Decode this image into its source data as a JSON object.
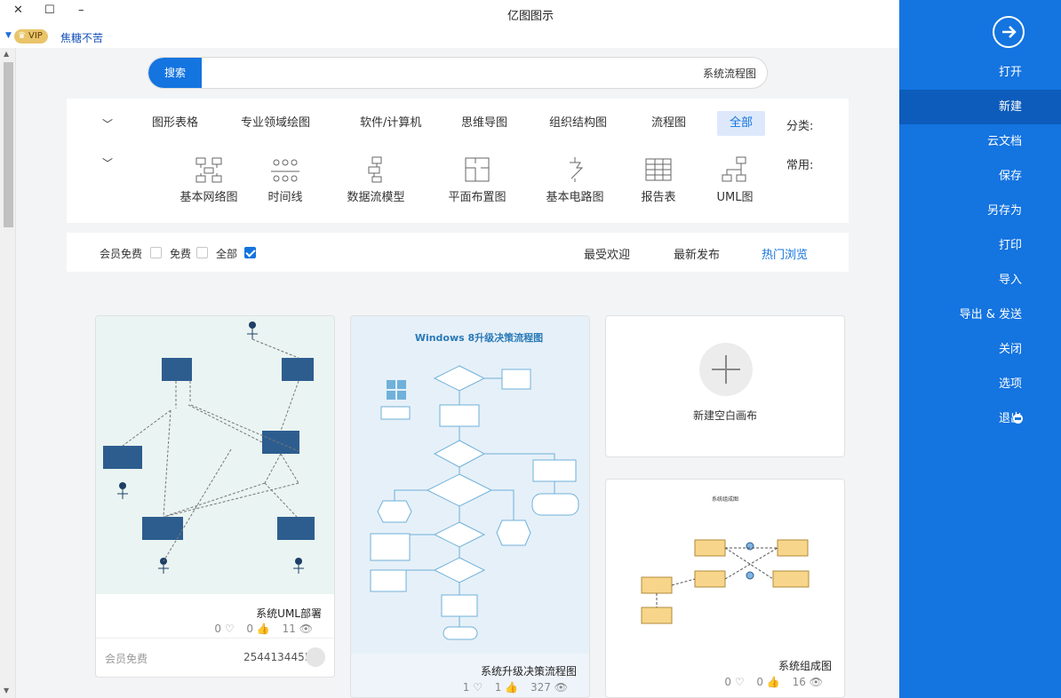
{
  "window": {
    "title": "亿图图示",
    "close": "✕",
    "maximize": "☐",
    "minimize": "–"
  },
  "user": {
    "vip": "VIP",
    "name": "焦糖不苦"
  },
  "search": {
    "button": "搜索",
    "value": "系统流程图"
  },
  "categories": {
    "label": "分类:",
    "items": [
      "全部",
      "流程图",
      "组织结构图",
      "思维导图",
      "软件/计算机",
      "专业领域绘图",
      "图形表格"
    ]
  },
  "common": {
    "label": "常用:",
    "items": [
      "UML图",
      "报告表",
      "基本电路图",
      "平面布置图",
      "数据流模型",
      "时间线",
      "基本网络图"
    ]
  },
  "filters": {
    "tabs": [
      "热门浏览",
      "最新发布",
      "最受欢迎"
    ],
    "checks": [
      "全部",
      "免费",
      "会员免费"
    ]
  },
  "cards": {
    "blank": {
      "label": "新建空白画布"
    },
    "uml": {
      "title": "系统UML部署",
      "views": "11",
      "likes": "0",
      "hearts": "0",
      "author": "2544134455",
      "tag": "会员免费"
    },
    "win": {
      "title": "系统升级决策流程图",
      "heading": "Windows 8升级决策流程图",
      "views": "327",
      "likes": "1",
      "hearts": "1"
    },
    "comp": {
      "title": "系统组成图",
      "heading": "系统组成图",
      "views": "16",
      "likes": "0",
      "hearts": "0"
    }
  },
  "sidebar": {
    "items": [
      "打开",
      "新建",
      "云文档",
      "保存",
      "另存为",
      "打印",
      "导入",
      "导出 & 发送",
      "关闭",
      "选项",
      "退出"
    ]
  },
  "colors": {
    "accent": "#1474e0",
    "sidebar": "#1474e0",
    "sidebar_selected": "#0d5cbb",
    "node_dark": "#2d5d8f",
    "node_yellow": "#f7d58a"
  }
}
